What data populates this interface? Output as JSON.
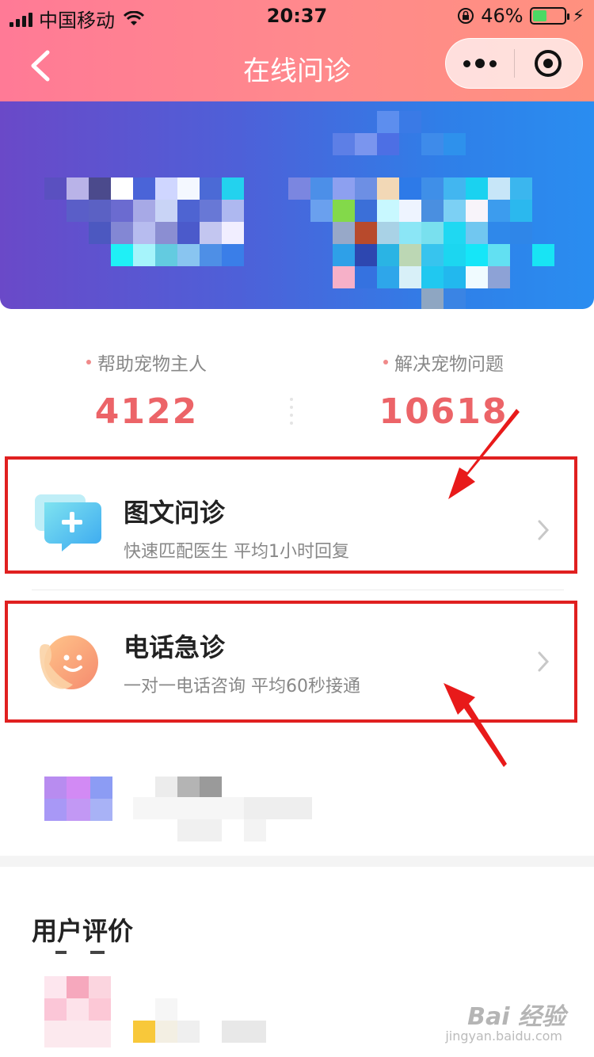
{
  "status_bar": {
    "carrier": "中国移动",
    "time": "20:37",
    "battery_percent": "46%",
    "battery_level": 0.46
  },
  "navbar": {
    "title": "在线问诊"
  },
  "stats": [
    {
      "label": "帮助宠物主人",
      "value": "4122"
    },
    {
      "label": "解决宠物问题",
      "value": "10618"
    }
  ],
  "services": [
    {
      "title": "图文问诊",
      "subtitle": "快速匹配医生 平均1小时回复",
      "icon": "chat-plus-icon"
    },
    {
      "title": "电话急诊",
      "subtitle": "一对一电话咨询 平均60秒接通",
      "icon": "smiley-phone-icon"
    }
  ],
  "reviews": {
    "title": "用户评价"
  },
  "watermark": {
    "brand": "Bai 经验",
    "url": "jingyan.baidu.com"
  },
  "colors": {
    "header_gradient_start": "#ff7a96",
    "header_gradient_end": "#ff917e",
    "stat_value": "#ec6468",
    "highlight_border": "#e02020"
  }
}
